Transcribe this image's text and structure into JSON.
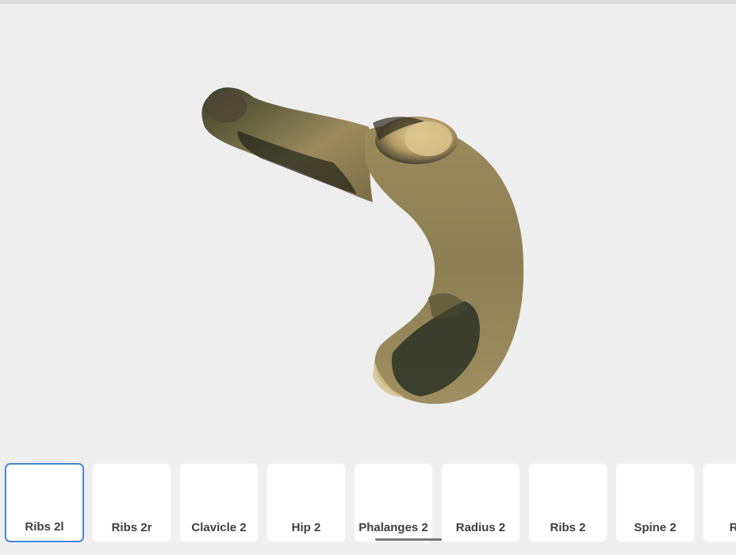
{
  "viewer": {
    "model_name": "bone-3d-model",
    "colors": {
      "background": "#eeeeee",
      "bone_light": "#c2a873",
      "bone_mid": "#8a7a4f",
      "bone_dark": "#2d3322"
    }
  },
  "carousel": {
    "selected_index": 0,
    "accent_color": "#4a86d8",
    "items": [
      {
        "label": "Ribs 2l"
      },
      {
        "label": "Ribs 2r"
      },
      {
        "label": "Clavicle 2"
      },
      {
        "label": "Hip 2"
      },
      {
        "label": "Phalanges 2"
      },
      {
        "label": "Radius 2"
      },
      {
        "label": "Ribs 2"
      },
      {
        "label": "Spine 2"
      },
      {
        "label": "Ribs"
      }
    ]
  }
}
